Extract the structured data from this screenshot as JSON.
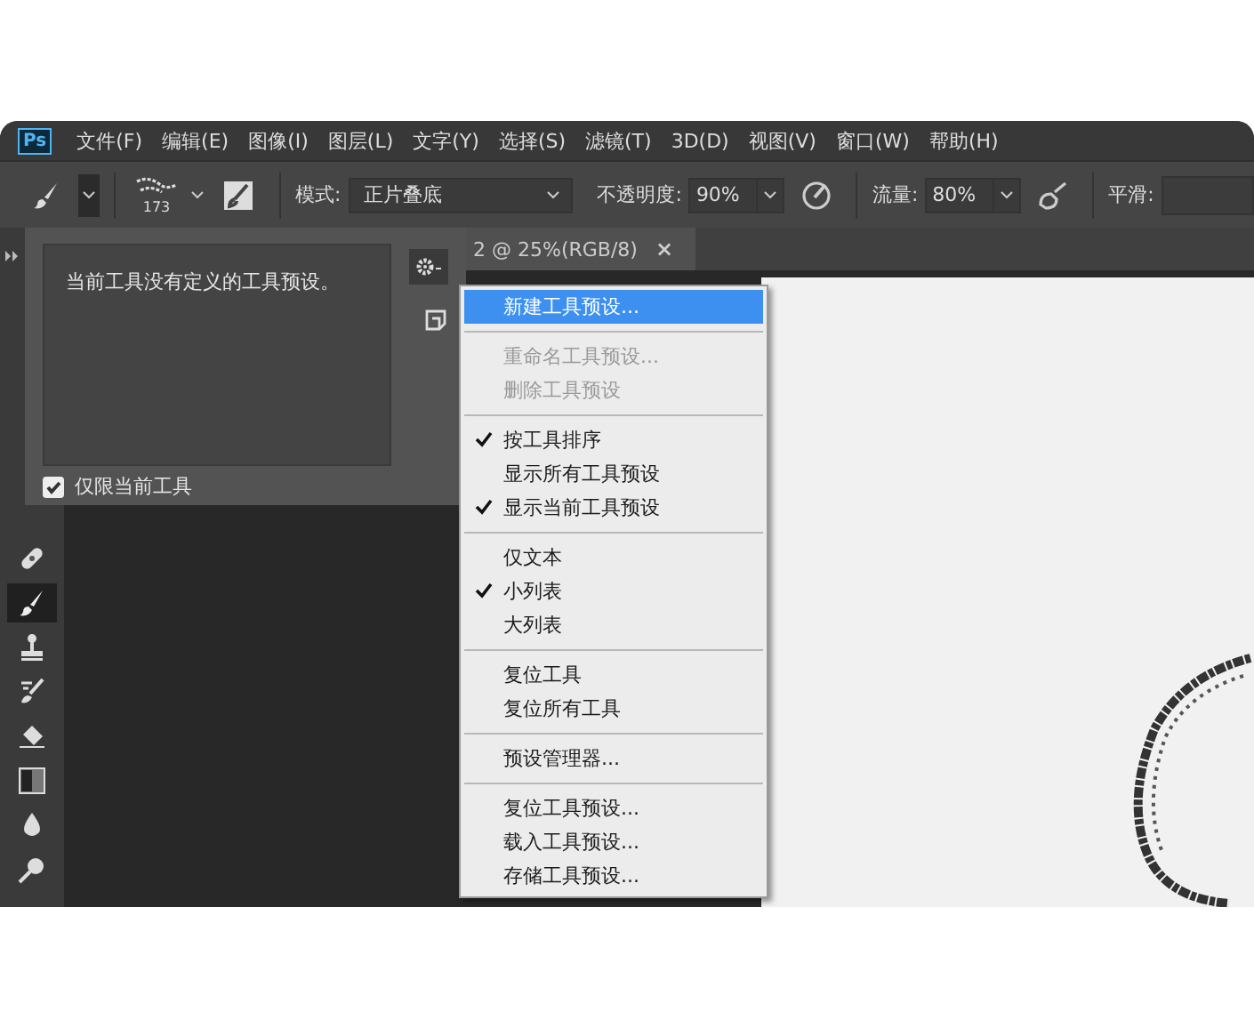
{
  "menu_bar": {
    "logo": "Ps",
    "items": [
      "文件(F)",
      "编辑(E)",
      "图像(I)",
      "图层(L)",
      "文字(Y)",
      "选择(S)",
      "滤镜(T)",
      "3D(D)",
      "视图(V)",
      "窗口(W)",
      "帮助(H)"
    ]
  },
  "options_bar": {
    "brush_size": "173",
    "mode_label": "模式:",
    "mode_value": "正片叠底",
    "opacity_label": "不透明度:",
    "opacity_value": "90%",
    "flow_label": "流量:",
    "flow_value": "80%",
    "smoothing_label": "平滑:"
  },
  "document_tab": {
    "title": "2 @ 25%(RGB/8)",
    "close": "×"
  },
  "tool_presets_panel": {
    "message": "当前工具没有定义的工具预设。",
    "only_current_tool": {
      "label": "仅限当前工具",
      "checked": true
    }
  },
  "tools": [
    {
      "kind": "healing",
      "selected": false
    },
    {
      "kind": "brush",
      "selected": true
    },
    {
      "kind": "stamp",
      "selected": false
    },
    {
      "kind": "history-brush",
      "selected": false
    },
    {
      "kind": "eraser",
      "selected": false
    },
    {
      "kind": "gradient",
      "selected": false
    },
    {
      "kind": "blur",
      "selected": false
    },
    {
      "kind": "dodge",
      "selected": false
    }
  ],
  "context_menu": {
    "items": [
      {
        "kind": "item",
        "label": "新建工具预设...",
        "selected": true,
        "disabled": false,
        "checked": false
      },
      {
        "kind": "separator"
      },
      {
        "kind": "item",
        "label": "重命名工具预设...",
        "selected": false,
        "disabled": true,
        "checked": false
      },
      {
        "kind": "item",
        "label": "删除工具预设",
        "selected": false,
        "disabled": true,
        "checked": false
      },
      {
        "kind": "separator"
      },
      {
        "kind": "item",
        "label": "按工具排序",
        "selected": false,
        "disabled": false,
        "checked": true
      },
      {
        "kind": "item",
        "label": "显示所有工具预设",
        "selected": false,
        "disabled": false,
        "checked": false
      },
      {
        "kind": "item",
        "label": "显示当前工具预设",
        "selected": false,
        "disabled": false,
        "checked": true
      },
      {
        "kind": "separator"
      },
      {
        "kind": "item",
        "label": "仅文本",
        "selected": false,
        "disabled": false,
        "checked": false
      },
      {
        "kind": "item",
        "label": "小列表",
        "selected": false,
        "disabled": false,
        "checked": true
      },
      {
        "kind": "item",
        "label": "大列表",
        "selected": false,
        "disabled": false,
        "checked": false
      },
      {
        "kind": "separator"
      },
      {
        "kind": "item",
        "label": "复位工具",
        "selected": false,
        "disabled": false,
        "checked": false
      },
      {
        "kind": "item",
        "label": "复位所有工具",
        "selected": false,
        "disabled": false,
        "checked": false
      },
      {
        "kind": "separator"
      },
      {
        "kind": "item",
        "label": "预设管理器...",
        "selected": false,
        "disabled": false,
        "checked": false
      },
      {
        "kind": "separator"
      },
      {
        "kind": "item",
        "label": "复位工具预设...",
        "selected": false,
        "disabled": false,
        "checked": false
      },
      {
        "kind": "item",
        "label": "载入工具预设...",
        "selected": false,
        "disabled": false,
        "checked": false
      },
      {
        "kind": "item",
        "label": "存储工具预设...",
        "selected": false,
        "disabled": false,
        "checked": false
      }
    ]
  }
}
